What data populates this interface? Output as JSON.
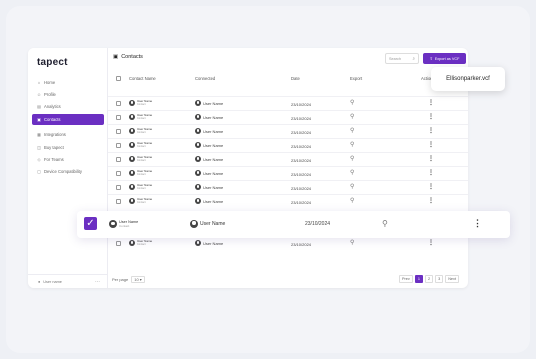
{
  "sidebar": {
    "logo": "tapect",
    "items": [
      {
        "label": "Home",
        "icon": "home-icon",
        "active": false
      },
      {
        "label": "Profile",
        "icon": "user-icon",
        "active": false
      },
      {
        "label": "Analytics",
        "icon": "analytics-icon",
        "active": false
      },
      {
        "label": "Contacts",
        "icon": "contacts-icon",
        "active": true
      },
      {
        "label": "Integrations",
        "icon": "integrations-icon",
        "active": false
      },
      {
        "label": "Buy tapect",
        "icon": "cart-icon",
        "active": false
      },
      {
        "label": "For Teams",
        "icon": "team-icon",
        "active": false
      },
      {
        "label": "Device Compatibility",
        "icon": "device-icon",
        "active": false
      }
    ],
    "user": "User name"
  },
  "header": {
    "title": "Contacts",
    "search_placeholder": "Search",
    "export_label": "Export as VCF"
  },
  "table": {
    "columns": [
      "Contact Name",
      "Connected",
      "Date",
      "Export",
      "Action"
    ],
    "rows": [
      {
        "contact_name": "User Name",
        "contact_sub": "Contact",
        "connected": "User Name",
        "date": "23/10/2024"
      },
      {
        "contact_name": "User Name",
        "contact_sub": "Contact",
        "connected": "User Name",
        "date": "23/10/2024"
      },
      {
        "contact_name": "User Name",
        "contact_sub": "Contact",
        "connected": "User Name",
        "date": "23/10/2024"
      },
      {
        "contact_name": "User Name",
        "contact_sub": "Contact",
        "connected": "User Name",
        "date": "23/10/2024"
      },
      {
        "contact_name": "User Name",
        "contact_sub": "Contact",
        "connected": "User Name",
        "date": "23/10/2024"
      },
      {
        "contact_name": "User Name",
        "contact_sub": "Contact",
        "connected": "User Name",
        "date": "23/10/2024"
      },
      {
        "contact_name": "User Name",
        "contact_sub": "Contact",
        "connected": "User Name",
        "date": "23/10/2024"
      },
      {
        "contact_name": "User Name",
        "contact_sub": "Contact",
        "connected": "User Name",
        "date": "23/10/2024"
      },
      {
        "contact_name": "User Name",
        "contact_sub": "Contact",
        "connected": "User Name",
        "date": "23/10/2024"
      }
    ],
    "highlighted_row": {
      "contact_name": "User Name",
      "contact_sub": "Contact",
      "connected": "User Name",
      "date": "23/10/2024",
      "checked": true
    }
  },
  "footer": {
    "per_page_label": "Per page",
    "per_page_value": "10",
    "prev": "Prev",
    "pages": [
      "1",
      "2",
      "3"
    ],
    "current_page": "1",
    "next": "Next"
  },
  "popup": {
    "filename": "Ellisonparker.vcf"
  },
  "colors": {
    "accent": "#6b2fc2",
    "background": "#eef0f5"
  }
}
